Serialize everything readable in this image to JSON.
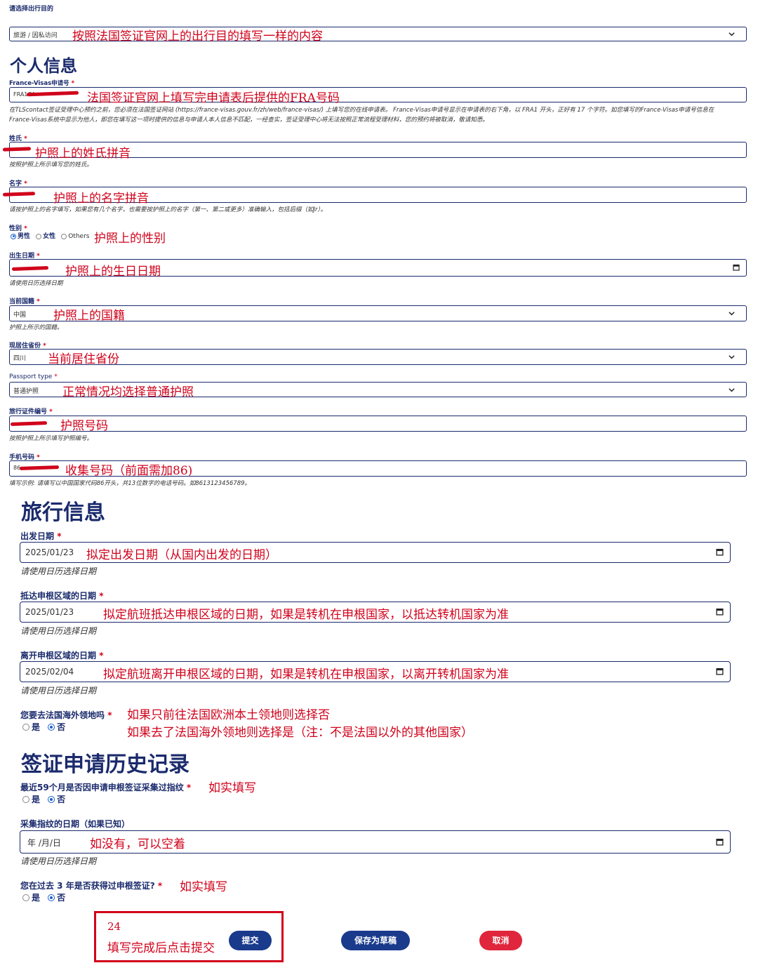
{
  "purpose": {
    "label": "请选择出行目的",
    "value": "旅游 / 因私访问",
    "note": "按照法国签证官网上的出行目的填写一样的内容"
  },
  "personal": {
    "title": "个人信息",
    "application_number": {
      "label": "France-Visas申请号",
      "value": "FRA1CA",
      "note": "法国签证官网上填写完申请表后提供的FRA号码",
      "help_line1": "在TLScontact签证受理中心预约之前，您必须在法国签证网站 (https://france-visas.gouv.fr/zh/web/france-visas/) 上填写您的在线申请表。 France-Visas申请号显示在申请表的右下角，以 FRA1 开头，正好有 17 个字符。如您填写的France-Visas申请号信息在",
      "help_line2": "France-Visas系统中显示为他人，即您在填写这一项时提供的信息与申请人本人信息不匹配，一经查实，签证受理中心将无法按照正常流程受理材料，您的预约将被取消，敬请知悉。"
    },
    "surname": {
      "label": "姓氏",
      "note": "护照上的姓氏拼音",
      "help": "按照护照上所示填写您的姓氏。"
    },
    "given_name": {
      "label": "名字",
      "note": "护照上的名字拼音",
      "help": "请按护照上的名字填写，如果您有几个名字，也需要按护照上的名字（第一、第二或更多）准确输入，包括后缀（如Jr）。"
    },
    "gender": {
      "label": "性别",
      "options": [
        "男性",
        "女性",
        "Others"
      ],
      "selected": 0,
      "note": "护照上的性别"
    },
    "birth_date": {
      "label": "出生日期",
      "note": "护照上的生日日期",
      "help": "请使用日历选择日期"
    },
    "nationality": {
      "label": "当前国籍",
      "value": "中国",
      "note": "护照上的国籍",
      "help": "护照上所示的国籍。"
    },
    "province": {
      "label": "现居住省份",
      "value": "四川",
      "note": "当前居住省份"
    },
    "passport_type": {
      "label": "Passport type",
      "value": "普通护照",
      "note": "正常情况均选择普通护照"
    },
    "passport_number": {
      "label": "旅行证件编号",
      "note": "护照号码",
      "help": "按照护照上所示填写护照编号。"
    },
    "phone": {
      "label": "手机号码",
      "value": "86",
      "note": "收集号码（前面需加86)",
      "help": "填写示例: 请填写以中国国家代码86开头，共13位数字的电话号码。如8613123456789。"
    }
  },
  "travel": {
    "title": "旅行信息",
    "departure": {
      "label": "出发日期",
      "value": "2025/01/23",
      "note": "拟定出发日期（从国内出发的日期）",
      "help": "请使用日历选择日期"
    },
    "arrival": {
      "label": "抵达申根区域的日期",
      "value": "2025/01/23",
      "note": "拟定航班抵达申根区域的日期，如果是转机在申根国家，以抵达转机国家为准",
      "help": "请使用日历选择日期"
    },
    "leave": {
      "label": "离开申根区域的日期",
      "value": "2025/02/04",
      "note": "拟定航班离开申根区域的日期，如果是转机在申根国家，以离开转机国家为准",
      "help": "请使用日历选择日期"
    },
    "overseas": {
      "label": "您要去法国海外领地吗",
      "options": [
        "是",
        "否"
      ],
      "selected": 1,
      "note_line1": "如果只前往法国欧洲本土领地则选择否",
      "note_line2": "如果去了法国海外领地则选择是（注：不是法国以外的其他国家）"
    }
  },
  "history": {
    "title": "签证申请历史记录",
    "fingerprint": {
      "label": "最近59个月是否因申请申根签证采集过指纹",
      "options": [
        "是",
        "否"
      ],
      "selected": 1,
      "note": "如实填写"
    },
    "fingerprint_date": {
      "label": "采集指纹的日期（如果已知）",
      "placeholder": "年 /月/日",
      "note": "如没有，可以空着",
      "help": "请使用日历选择日期"
    },
    "past_visa": {
      "label": "您在过去 3 年是否获得过申根签证?",
      "options": [
        "是",
        "否"
      ],
      "selected": 1,
      "note": "如实填写"
    }
  },
  "footer": {
    "step_number": "24",
    "step_note": "填写完成后点击提交",
    "submit_label": "提交",
    "draft_label": "保存为草稿",
    "cancel_label": "取消"
  },
  "icons": [
    "chevron-down-icon",
    "calendar-icon",
    "radio-icon"
  ],
  "colors": {
    "brand": "#1a2a6c",
    "annotation": "#d0021b",
    "button": "#1a3a8c",
    "cancel": "#e0263c"
  }
}
